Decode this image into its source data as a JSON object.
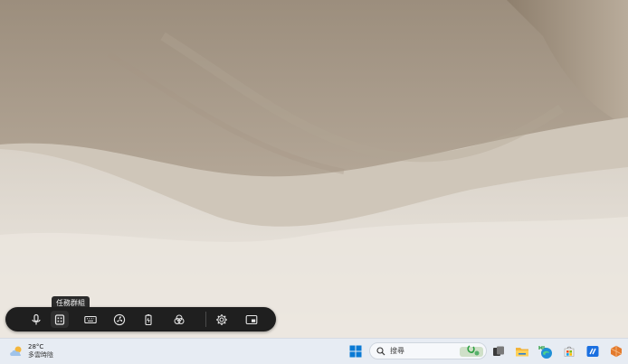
{
  "tooltip": {
    "text": "任務群組"
  },
  "toolbar": {
    "tools": [
      {
        "name": "microphone-icon"
      },
      {
        "name": "task-group-icon"
      },
      {
        "name": "keyboard-icon"
      },
      {
        "name": "fan-icon"
      },
      {
        "name": "battery-icon"
      },
      {
        "name": "color-filter-icon"
      },
      {
        "name": "settings-gear-icon"
      },
      {
        "name": "picture-in-picture-icon"
      }
    ]
  },
  "taskbar": {
    "weather": {
      "temperature": "28°C",
      "condition": "多雲時陰"
    },
    "search": {
      "placeholder": "搜尋"
    },
    "apps": [
      {
        "name": "start-icon"
      },
      {
        "name": "search-icon"
      },
      {
        "name": "task-view-icon"
      },
      {
        "name": "file-explorer-icon"
      },
      {
        "name": "edge-browser-icon"
      },
      {
        "name": "store-icon"
      },
      {
        "name": "blue-app-icon"
      },
      {
        "name": "orange-app-icon"
      }
    ],
    "colors": {
      "taskbar_bg": "#e7ecf3",
      "toolbar_bg": "#1f1f1f",
      "accent": "#0078d4"
    }
  }
}
